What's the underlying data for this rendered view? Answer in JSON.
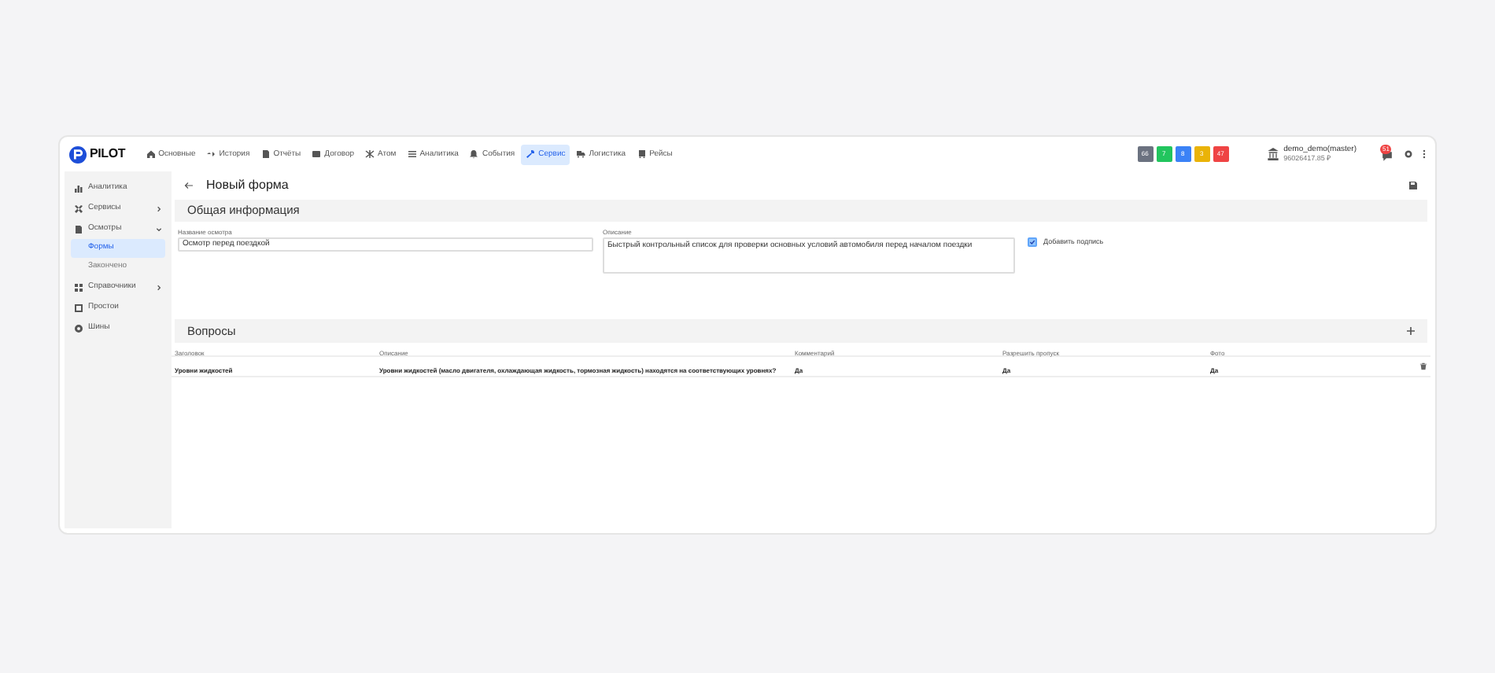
{
  "logo": "PILOT",
  "nav": [
    {
      "label": "Основные",
      "selected": false
    },
    {
      "label": "История",
      "selected": false
    },
    {
      "label": "Отчёты",
      "selected": false
    },
    {
      "label": "Договор",
      "selected": false
    },
    {
      "label": "Атом",
      "selected": false
    },
    {
      "label": "Аналитика",
      "selected": false
    },
    {
      "label": "События",
      "selected": false
    },
    {
      "label": "Сервис",
      "selected": true
    },
    {
      "label": "Логистика",
      "selected": false
    },
    {
      "label": "Рейсы",
      "selected": false
    }
  ],
  "counters": [
    {
      "text": "66",
      "color": "#6b7280"
    },
    {
      "text": "7",
      "color": "#22c55e"
    },
    {
      "text": "8",
      "color": "#3b82f6"
    },
    {
      "text": "3",
      "color": "#eab308"
    },
    {
      "text": "47",
      "color": "#ef4444"
    }
  ],
  "user": {
    "name": "demo_demo(master)",
    "balance": "96026417.85 ₽"
  },
  "notifications": "51",
  "sidebar": [
    {
      "label": "Аналитика",
      "selected": false
    },
    {
      "label": "Сервисы",
      "selected": false,
      "expanded": false
    },
    {
      "label": "Осмотры",
      "selected": false,
      "expanded": true,
      "children": [
        {
          "label": "Формы",
          "selected": true
        },
        {
          "label": "Закончено",
          "selected": false
        }
      ]
    },
    {
      "label": "Справочники",
      "selected": false,
      "expanded": false
    },
    {
      "label": "Простои",
      "selected": false
    },
    {
      "label": "Шины",
      "selected": false
    }
  ],
  "page_title": "Новый форма",
  "general": {
    "title": "Общая информация",
    "name_label": "Название осмотра",
    "name_value": "Осмотр перед поездкой",
    "description_label": "Описание",
    "description_value": "Быстрый контрольный список для проверки основных условий автомобиля перед началом поездки",
    "signature": {
      "label": "Добавить подпись",
      "checked": true
    }
  },
  "questions": {
    "title": "Вопросы",
    "columns": [
      "Заголовок",
      "Описание",
      "Комментарий",
      "Разрешить пропуск",
      "Фото"
    ],
    "rows": [
      [
        "Уровни жидкостей",
        "Уровни жидкостей (масло двигателя, охлаждающая жидкость, тормозная жидкость) находятся на соответствующих уровнях?",
        "Да",
        "Да",
        "Да"
      ]
    ]
  }
}
